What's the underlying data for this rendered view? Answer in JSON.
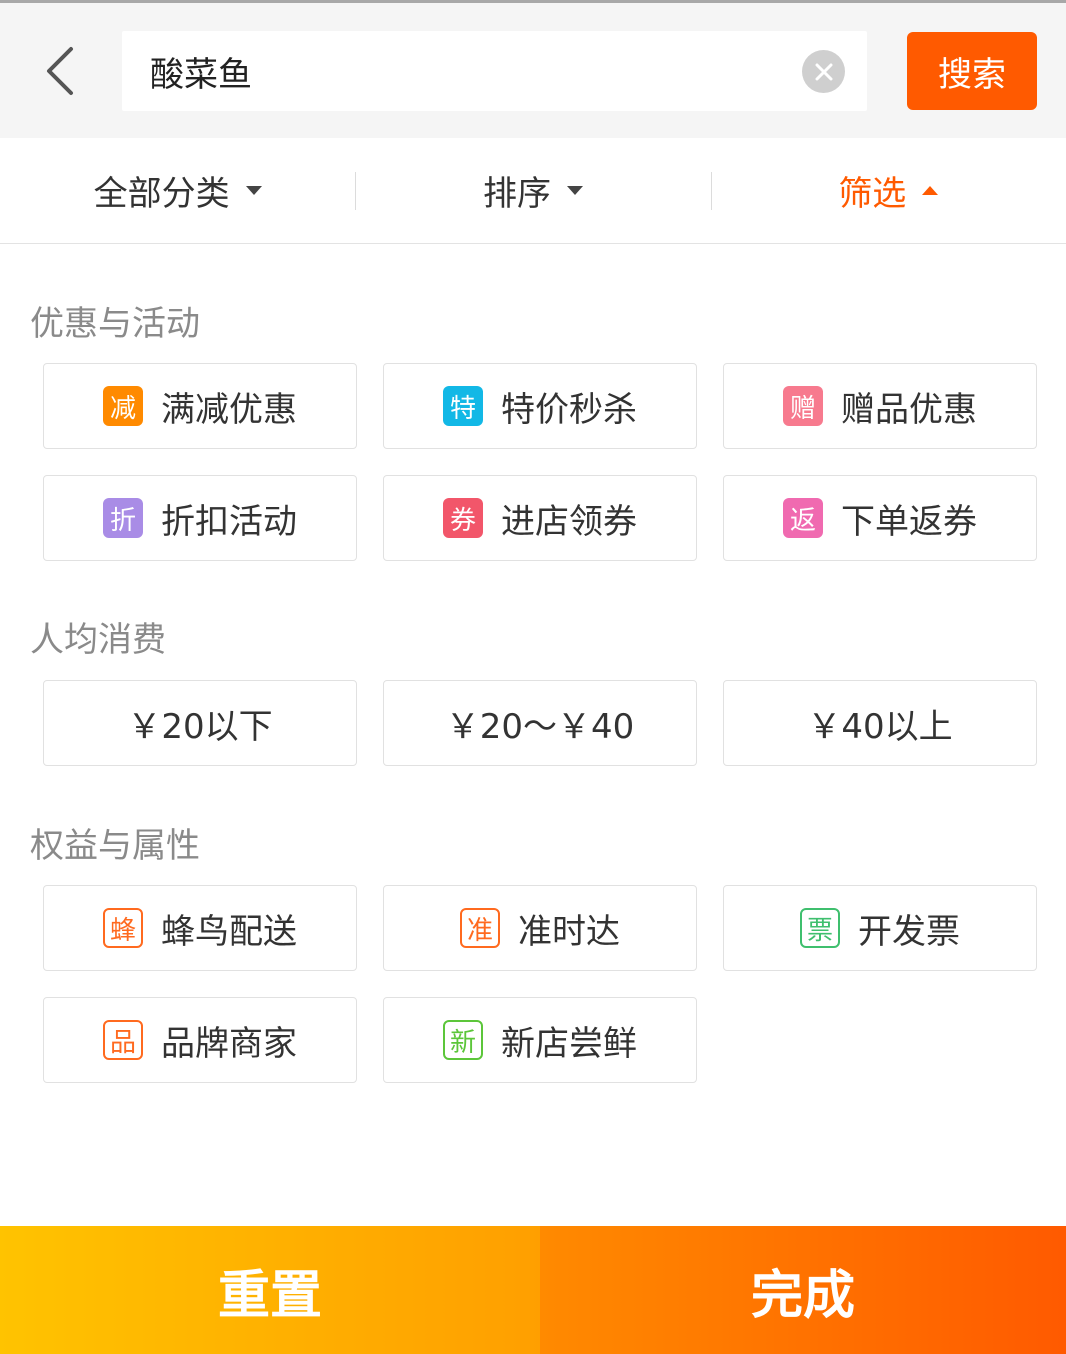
{
  "search": {
    "value": "酸菜鱼",
    "button_label": "搜索"
  },
  "tabs": [
    {
      "label": "全部分类",
      "state": "collapsed"
    },
    {
      "label": "排序",
      "state": "collapsed"
    },
    {
      "label": "筛选",
      "state": "expanded"
    }
  ],
  "sections": {
    "promotions": {
      "title": "优惠与活动",
      "options": [
        {
          "badge": "减",
          "label": "满减优惠",
          "badge_color": "#ff8a00"
        },
        {
          "badge": "特",
          "label": "特价秒杀",
          "badge_color": "#12b8e6"
        },
        {
          "badge": "赠",
          "label": "赠品优惠",
          "badge_color": "#f77a8e"
        },
        {
          "badge": "折",
          "label": "折扣活动",
          "badge_color": "#a98ce6"
        },
        {
          "badge": "券",
          "label": "进店领券",
          "badge_color": "#f2566a"
        },
        {
          "badge": "返",
          "label": "下单返券",
          "badge_color": "#f06ab0"
        }
      ]
    },
    "price": {
      "title": "人均消费",
      "options": [
        {
          "label": "￥20以下"
        },
        {
          "label": "￥20～￥40"
        },
        {
          "label": "￥40以上"
        }
      ]
    },
    "attributes": {
      "title": "权益与属性",
      "options": [
        {
          "badge": "蜂",
          "label": "蜂鸟配送",
          "badge_color": "#ff6a1f"
        },
        {
          "badge": "准",
          "label": "准时达",
          "badge_color": "#ff6a1f"
        },
        {
          "badge": "票",
          "label": "开发票",
          "badge_color": "#3fbf6e"
        },
        {
          "badge": "品",
          "label": "品牌商家",
          "badge_color": "#ff6a1f"
        },
        {
          "badge": "新",
          "label": "新店尝鲜",
          "badge_color": "#5cc63a"
        }
      ]
    }
  },
  "footer": {
    "reset_label": "重置",
    "done_label": "完成"
  }
}
